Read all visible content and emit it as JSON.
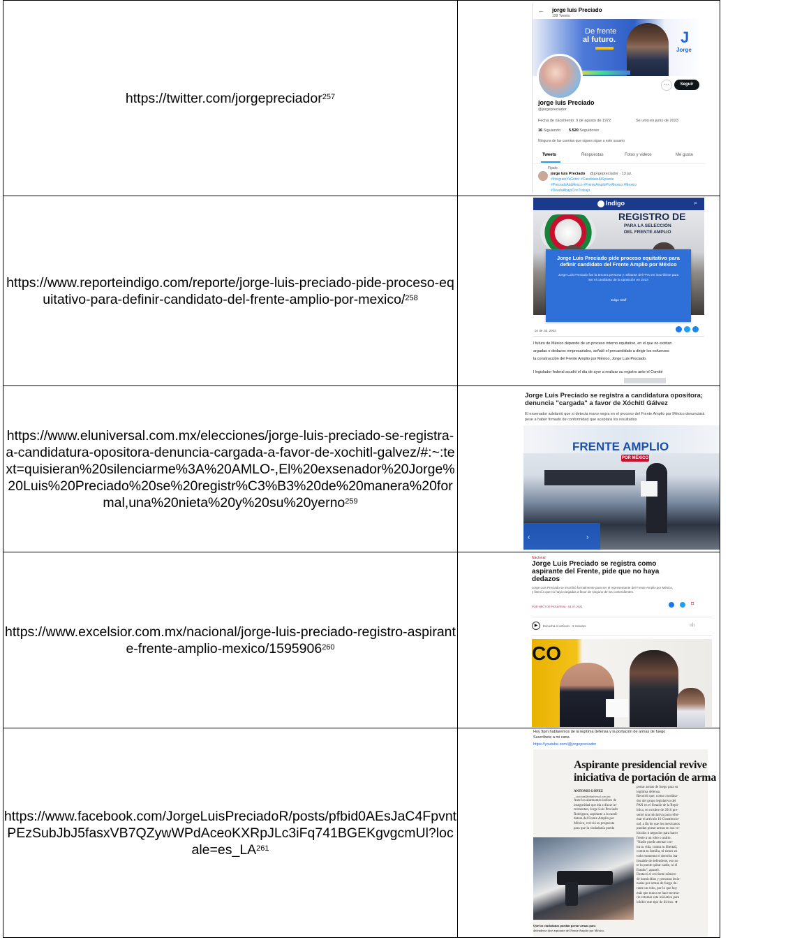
{
  "rows": [
    {
      "url": "https://twitter.com/jorgepreciador",
      "note": "257"
    },
    {
      "url": "https://www.reporteindigo.com/reporte/jorge-luis-preciado-pide-proceso-equitativo-para-definir-candidato-del-frente-amplio-por-mexico/",
      "note": "258"
    },
    {
      "url": "https://www.eluniversal.com.mx/elecciones/jorge-luis-preciado-se-registra-a-candidatura-opositora-denuncia-cargada-a-favor-de-xochitl-galvez/#:~:text=quisieran%20silenciarme%3A%20AMLO-,El%20exsenador%20Jorge%20Luis%20Preciado%20se%20registr%C3%B3%20de%20manera%20formal,una%20nieta%20y%20su%20yerno",
      "note": "259"
    },
    {
      "url": "https://www.excelsior.com.mx/nacional/jorge-luis-preciado-registro-aspirante-frente-amplio-mexico/1595906",
      "note": "260"
    },
    {
      "url": "https://www.facebook.com/JorgeLuisPreciadoR/posts/pfbid0AEsJaC4FpvntPEzSubJbJ5fasxVB7QZywWPdAceoKXRpJLc3iFq741BGEKgvgcmUl?locale=es_LA",
      "note": "261"
    }
  ],
  "twitter": {
    "name": "jorge luis Preciado",
    "tweets_count": "128 Tweets",
    "banner_line1": "De frente",
    "banner_line2": "al futuro.",
    "logo_letter": "J",
    "logo_word": "Jorge",
    "follow_button": "Seguir",
    "handle": "@jorgepreciador",
    "birth": "Fecha de nacimiento: 9 de agosto de 1972",
    "joined": "Se unió en junio de 2023",
    "following_num": "16",
    "following_label": "Siguiendo",
    "followers_num": "5.520",
    "followers_label": "Seguidores",
    "mutuals": "Ninguna de las cuentas que sigues sigue a este usuario",
    "tabs": [
      "Tweets",
      "Respuestas",
      "Fotos y videos",
      "Me gusta"
    ],
    "pinned": "Fijado",
    "tweet_author": "jorge luis Preciado",
    "tweet_meta": "@jorgepreciador · 13 jul.",
    "tweet_line1": "#IntegrateYaGritin! #CandidatoAlSprante",
    "tweet_line2": "#PreciadoAlaMexico #FrenteAmplioPorMexico #Mexico",
    "tweet_line3": "#DeudaAbajoConTrabajo"
  },
  "indigo": {
    "brand": "Indigo",
    "banner_title": "REGISTRO DE",
    "banner_sub1": "PARA LA SELECCIÓN",
    "banner_sub2": "DEL FRENTE AMPLIO",
    "headline": "Jorge Luis Preciado pide proceso equitativo para definir candidato del Frente Amplio por México",
    "dek": "Jorge Luis Preciado fue la tercera persona y militante del PAN en inscribirse para ser el candidato de la oposición en 2024",
    "byline": "Indigo Staff",
    "date": "04 de Jul, 2023",
    "body1": "l futuro de México depende de un proceso interno equitativo, en el que no existan",
    "body2": "argadas o dedazos empresariales, señaló el precandidato a dirigir los esfuerzos",
    "body3": "la construcción del Frente Amplio por México, Jorge Luis Preciado.",
    "body4": "l legislador federal acudió el día de ayer a realizar su registro ante el Comité"
  },
  "universal": {
    "headline1": "Jorge Luis Preciado se registra a candidatura opositora;",
    "headline2": "denuncia \"cargada\" a favor de Xóchitl Gálvez",
    "dek1": "El exsenador adelantó que si detecta mano negra en el proceso del Frente Amplio por México denunciará",
    "dek2": "pese a haber firmado de conformidad que aceptará los resultados",
    "banner": "FRENTE AMPLIO",
    "banner_sub": "POR MÉXICO"
  },
  "excelsior": {
    "section": "Nacional",
    "headline1": "Jorge Luis Preciado se registra como",
    "headline2": "aspirante del Frente, pide que no haya",
    "headline3": "dedazos",
    "dek1": "Jorge Luis Preciado se inscribió formalmente para ser el representante del Frente Amplio por México,",
    "dek2": "y llamó a que no haya cargadas a favor de ninguno de los contendientes.",
    "byline": "POR HÉCTOR FIGUEROA · 04-07-2023",
    "audio": "Escucha el artículo · 3 minutos",
    "wall_text": "CO"
  },
  "facebook": {
    "post_line1": "Hoy 9pm hablaremos de la legítima defensa y la portación de armas de fuego",
    "post_line2": "Suscríbete a mi cana",
    "link": "https://youtube.com/@jorgepreciador",
    "headline1": "Aspirante presidencial revive",
    "headline2": "iniciativa de portación de arma",
    "author": "ANTONIO LÓPEZ",
    "email": "—nacional@eluniversal.com.mx",
    "col1": [
      "Ante los alarmantes índices de",
      "inseguridad que día a día se in-",
      "crementan, Jorge Luis Preciado",
      "Rodríguez, aspirante a la candi-",
      "datura del Frente Amplio por",
      "México, revivió su propuesta",
      "para que la ciudadanía pueda"
    ],
    "col2": [
      "portar armas de fuego para su",
      "legítima defensa.",
      "Recordó que, como coordina-",
      "dor del grupo legislativo del",
      "PAN en el Senado de la Repú-",
      "blica, en octubre de 2016 pre-",
      "sentó una iniciativa para refor-",
      "mar el artículo 10 Constitucio-",
      "nal, a fin de que los mexicanos",
      "puedan portar armas en sus ve-",
      "hículos o negocios para hacer",
      "frente a un robo o asalto.",
      "\"Nadie puede atentar con-",
      "tra tu vida, contra tu libertad,",
      "contra tu familia, tú tienes en",
      "todo momento el derecho ina-",
      "lienable de defenderte, eso no",
      "te lo puede quitar nadie, ni el",
      "Estado\", apuntó.",
      "Destacó el creciente número",
      "de homicidios y personas lesio-",
      "nadas por armas de fuego du-",
      "rante un robo, por lo que hoy",
      "más que nunca se hace necesa-",
      "rio retomar esta iniciativa para",
      "inhibir este tipo de ilícitos. ★"
    ],
    "caption1": "Que los ciudadanos puedan portar armas para",
    "caption2": "defenderse dice aspirante del Frente Amplio por México."
  }
}
